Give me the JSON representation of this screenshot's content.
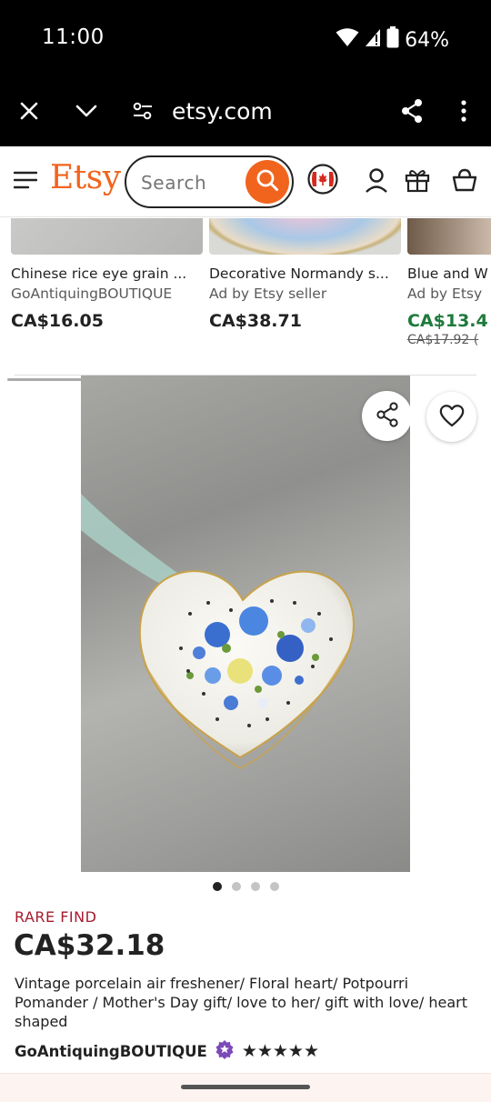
{
  "status_bar": {
    "time": "11:00",
    "battery": "64%"
  },
  "browser": {
    "url": "etsy.com"
  },
  "header": {
    "logo": "Etsy",
    "search_placeholder": "Search"
  },
  "carousel": [
    {
      "title": "Chinese rice eye grain ...",
      "subtitle": "GoAntiquingBOUTIQUE",
      "price": "CA$16.05"
    },
    {
      "title": "Decorative Normandy s...",
      "subtitle": "Ad by Etsy seller",
      "price": "CA$38.71"
    },
    {
      "title": "Blue and W",
      "subtitle": "Ad by Etsy",
      "price": "CA$13.4",
      "original_price": "CA$17.92 ("
    }
  ],
  "product": {
    "image_count": 4,
    "active_image": 1,
    "badge": "RARE FIND",
    "price": "CA$32.18",
    "title": "Vintage porcelain air freshener/ Floral heart/ Potpourri Pomander / Mother's Day gift/ love to her/ gift with love/ heart shaped",
    "shop": "GoAntiquingBOUTIQUE",
    "rating_stars": 5,
    "stars_text": "★★★★★"
  },
  "colors": {
    "brand": "#f1641e",
    "rare_find": "#a61a2e",
    "sale_price": "#1e7a3b",
    "star_seller_badge": "#7b4ab8"
  }
}
